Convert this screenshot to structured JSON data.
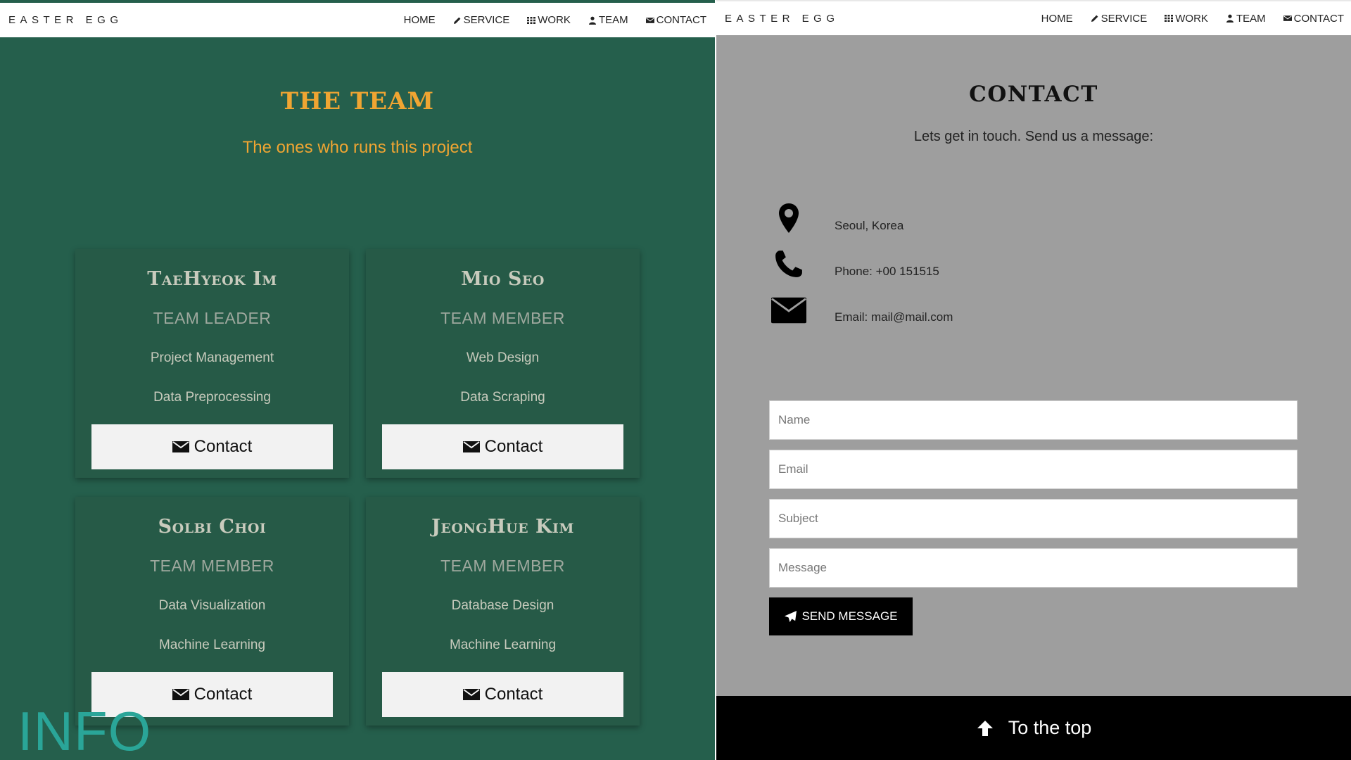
{
  "left": {
    "nav": {
      "brand": "EASTER EGG",
      "links": [
        {
          "label": "HOME",
          "icon": ""
        },
        {
          "label": "SERVICE",
          "icon": "pencil-icon"
        },
        {
          "label": "WORK",
          "icon": "grid-icon"
        },
        {
          "label": "TEAM",
          "icon": "user-icon"
        },
        {
          "label": "CONTACT",
          "icon": "envelope-icon"
        }
      ]
    },
    "team": {
      "title": "THE TEAM",
      "subtitle": "The ones who runs this project",
      "members": [
        {
          "name": "TaeHyeok Im",
          "role": "TEAM LEADER",
          "skills": [
            "Project Management",
            "Data Preprocessing"
          ],
          "button_label": "Contact"
        },
        {
          "name": "Mio Seo",
          "role": "TEAM MEMBER",
          "skills": [
            "Web Design",
            "Data Scraping"
          ],
          "button_label": "Contact"
        },
        {
          "name": "Solbi Choi",
          "role": "TEAM MEMBER",
          "skills": [
            "Data Visualization",
            "Machine Learning"
          ],
          "button_label": "Contact"
        },
        {
          "name": "JeongHue Kim",
          "role": "TEAM MEMBER",
          "skills": [
            "Database Design",
            "Machine Learning"
          ],
          "button_label": "Contact"
        }
      ]
    },
    "watermark": "INFO"
  },
  "right": {
    "nav": {
      "brand": "EASTER EGG",
      "links": [
        {
          "label": "HOME",
          "icon": ""
        },
        {
          "label": "SERVICE",
          "icon": "pencil-icon"
        },
        {
          "label": "WORK",
          "icon": "grid-icon"
        },
        {
          "label": "TEAM",
          "icon": "user-icon"
        },
        {
          "label": "CONTACT",
          "icon": "envelope-icon"
        }
      ]
    },
    "contact": {
      "title": "CONTACT",
      "subtitle": "Lets get in touch. Send us a message:",
      "info": [
        {
          "icon": "map-marker-icon",
          "text": "Seoul, Korea"
        },
        {
          "icon": "phone-icon",
          "text": "Phone: +00 151515"
        },
        {
          "icon": "envelope-icon",
          "text": "Email: mail@mail.com"
        }
      ],
      "form": {
        "name_placeholder": "Name",
        "email_placeholder": "Email",
        "subject_placeholder": "Subject",
        "message_placeholder": "Message",
        "send_label": "SEND MESSAGE"
      }
    },
    "footer": {
      "label": "To the top",
      "icon": "arrow-up-icon"
    }
  },
  "colors": {
    "team_bg": "#255f4c",
    "accent_orange": "#f0a532",
    "contact_bg": "#9e9e9e",
    "watermark": "#2aa598"
  }
}
